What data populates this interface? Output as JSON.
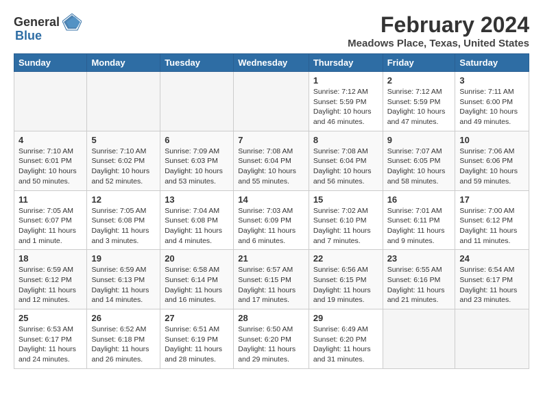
{
  "logo": {
    "text_general": "General",
    "text_blue": "Blue"
  },
  "header": {
    "title": "February 2024",
    "subtitle": "Meadows Place, Texas, United States"
  },
  "days_of_week": [
    "Sunday",
    "Monday",
    "Tuesday",
    "Wednesday",
    "Thursday",
    "Friday",
    "Saturday"
  ],
  "weeks": [
    [
      {
        "day": "",
        "info": ""
      },
      {
        "day": "",
        "info": ""
      },
      {
        "day": "",
        "info": ""
      },
      {
        "day": "",
        "info": ""
      },
      {
        "day": "1",
        "info": "Sunrise: 7:12 AM\nSunset: 5:59 PM\nDaylight: 10 hours\nand 46 minutes."
      },
      {
        "day": "2",
        "info": "Sunrise: 7:12 AM\nSunset: 5:59 PM\nDaylight: 10 hours\nand 47 minutes."
      },
      {
        "day": "3",
        "info": "Sunrise: 7:11 AM\nSunset: 6:00 PM\nDaylight: 10 hours\nand 49 minutes."
      }
    ],
    [
      {
        "day": "4",
        "info": "Sunrise: 7:10 AM\nSunset: 6:01 PM\nDaylight: 10 hours\nand 50 minutes."
      },
      {
        "day": "5",
        "info": "Sunrise: 7:10 AM\nSunset: 6:02 PM\nDaylight: 10 hours\nand 52 minutes."
      },
      {
        "day": "6",
        "info": "Sunrise: 7:09 AM\nSunset: 6:03 PM\nDaylight: 10 hours\nand 53 minutes."
      },
      {
        "day": "7",
        "info": "Sunrise: 7:08 AM\nSunset: 6:04 PM\nDaylight: 10 hours\nand 55 minutes."
      },
      {
        "day": "8",
        "info": "Sunrise: 7:08 AM\nSunset: 6:04 PM\nDaylight: 10 hours\nand 56 minutes."
      },
      {
        "day": "9",
        "info": "Sunrise: 7:07 AM\nSunset: 6:05 PM\nDaylight: 10 hours\nand 58 minutes."
      },
      {
        "day": "10",
        "info": "Sunrise: 7:06 AM\nSunset: 6:06 PM\nDaylight: 10 hours\nand 59 minutes."
      }
    ],
    [
      {
        "day": "11",
        "info": "Sunrise: 7:05 AM\nSunset: 6:07 PM\nDaylight: 11 hours\nand 1 minute."
      },
      {
        "day": "12",
        "info": "Sunrise: 7:05 AM\nSunset: 6:08 PM\nDaylight: 11 hours\nand 3 minutes."
      },
      {
        "day": "13",
        "info": "Sunrise: 7:04 AM\nSunset: 6:08 PM\nDaylight: 11 hours\nand 4 minutes."
      },
      {
        "day": "14",
        "info": "Sunrise: 7:03 AM\nSunset: 6:09 PM\nDaylight: 11 hours\nand 6 minutes."
      },
      {
        "day": "15",
        "info": "Sunrise: 7:02 AM\nSunset: 6:10 PM\nDaylight: 11 hours\nand 7 minutes."
      },
      {
        "day": "16",
        "info": "Sunrise: 7:01 AM\nSunset: 6:11 PM\nDaylight: 11 hours\nand 9 minutes."
      },
      {
        "day": "17",
        "info": "Sunrise: 7:00 AM\nSunset: 6:12 PM\nDaylight: 11 hours\nand 11 minutes."
      }
    ],
    [
      {
        "day": "18",
        "info": "Sunrise: 6:59 AM\nSunset: 6:12 PM\nDaylight: 11 hours\nand 12 minutes."
      },
      {
        "day": "19",
        "info": "Sunrise: 6:59 AM\nSunset: 6:13 PM\nDaylight: 11 hours\nand 14 minutes."
      },
      {
        "day": "20",
        "info": "Sunrise: 6:58 AM\nSunset: 6:14 PM\nDaylight: 11 hours\nand 16 minutes."
      },
      {
        "day": "21",
        "info": "Sunrise: 6:57 AM\nSunset: 6:15 PM\nDaylight: 11 hours\nand 17 minutes."
      },
      {
        "day": "22",
        "info": "Sunrise: 6:56 AM\nSunset: 6:15 PM\nDaylight: 11 hours\nand 19 minutes."
      },
      {
        "day": "23",
        "info": "Sunrise: 6:55 AM\nSunset: 6:16 PM\nDaylight: 11 hours\nand 21 minutes."
      },
      {
        "day": "24",
        "info": "Sunrise: 6:54 AM\nSunset: 6:17 PM\nDaylight: 11 hours\nand 23 minutes."
      }
    ],
    [
      {
        "day": "25",
        "info": "Sunrise: 6:53 AM\nSunset: 6:17 PM\nDaylight: 11 hours\nand 24 minutes."
      },
      {
        "day": "26",
        "info": "Sunrise: 6:52 AM\nSunset: 6:18 PM\nDaylight: 11 hours\nand 26 minutes."
      },
      {
        "day": "27",
        "info": "Sunrise: 6:51 AM\nSunset: 6:19 PM\nDaylight: 11 hours\nand 28 minutes."
      },
      {
        "day": "28",
        "info": "Sunrise: 6:50 AM\nSunset: 6:20 PM\nDaylight: 11 hours\nand 29 minutes."
      },
      {
        "day": "29",
        "info": "Sunrise: 6:49 AM\nSunset: 6:20 PM\nDaylight: 11 hours\nand 31 minutes."
      },
      {
        "day": "",
        "info": ""
      },
      {
        "day": "",
        "info": ""
      }
    ]
  ]
}
